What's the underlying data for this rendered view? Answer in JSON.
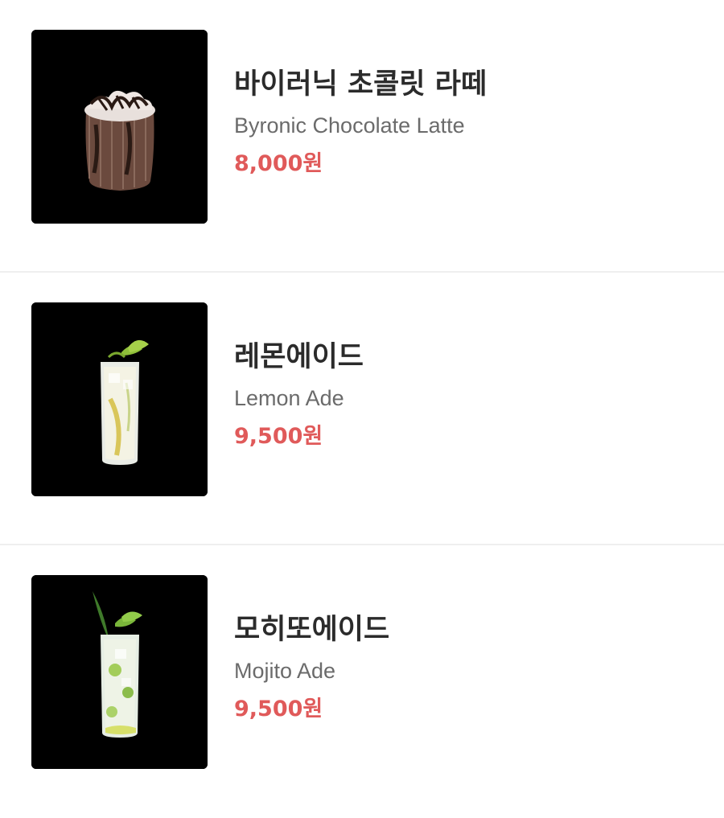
{
  "menu": {
    "items": [
      {
        "name_ko": "바이러닉 초콜릿 라떼",
        "name_en": "Byronic Chocolate Latte",
        "price": "8,000원",
        "image_icon": "chocolate-latte-drink-icon"
      },
      {
        "name_ko": "레몬에이드",
        "name_en": "Lemon Ade",
        "price": "9,500원",
        "image_icon": "lemonade-drink-icon"
      },
      {
        "name_ko": "모히또에이드",
        "name_en": "Mojito Ade",
        "price": "9,500원",
        "image_icon": "mojito-drink-icon"
      }
    ]
  },
  "colors": {
    "price": "#e05a5a",
    "name": "#2b2b2b",
    "subtitle": "#6b6b6b",
    "thumbnail_bg": "#000000",
    "divider": "#efefef"
  }
}
